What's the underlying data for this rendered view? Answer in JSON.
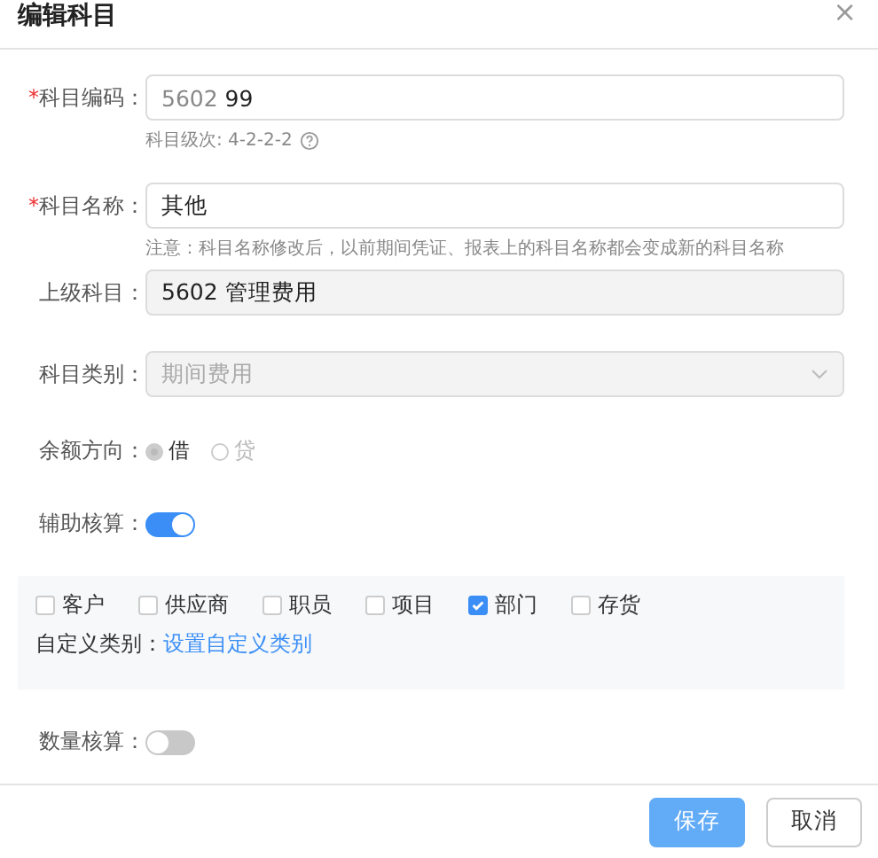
{
  "dialog": {
    "title": "编辑科目",
    "close": "×"
  },
  "form": {
    "code": {
      "label": "科目编码：",
      "required_mark": "*",
      "prefix": "5602",
      "value": "99",
      "hint": "科目级次: 4-2-2-2"
    },
    "name": {
      "label": "科目名称：",
      "required_mark": "*",
      "value": "其他",
      "notice": "注意：科目名称修改后，以前期间凭证、报表上的科目名称都会变成新的科目名称"
    },
    "parent": {
      "label": "上级科目：",
      "value": "5602 管理费用",
      "disabled": true
    },
    "category": {
      "label": "科目类别：",
      "value": "期间费用",
      "disabled": true
    },
    "balance": {
      "label": "余额方向：",
      "options": [
        {
          "label": "借",
          "selected": true
        },
        {
          "label": "贷",
          "selected": false
        }
      ]
    },
    "auxiliary": {
      "label": "辅助核算：",
      "on": true,
      "types": [
        {
          "label": "客户",
          "checked": false
        },
        {
          "label": "供应商",
          "checked": false
        },
        {
          "label": "职员",
          "checked": false
        },
        {
          "label": "项目",
          "checked": false
        },
        {
          "label": "部门",
          "checked": true
        },
        {
          "label": "存货",
          "checked": false
        }
      ],
      "custom_label": "自定义类别：",
      "custom_link": "设置自定义类别"
    },
    "quantity": {
      "label": "数量核算：",
      "on": false
    }
  },
  "buttons": [
    {
      "label": "保存",
      "kind": "primary"
    },
    {
      "label": "取消",
      "kind": "default"
    }
  ]
}
